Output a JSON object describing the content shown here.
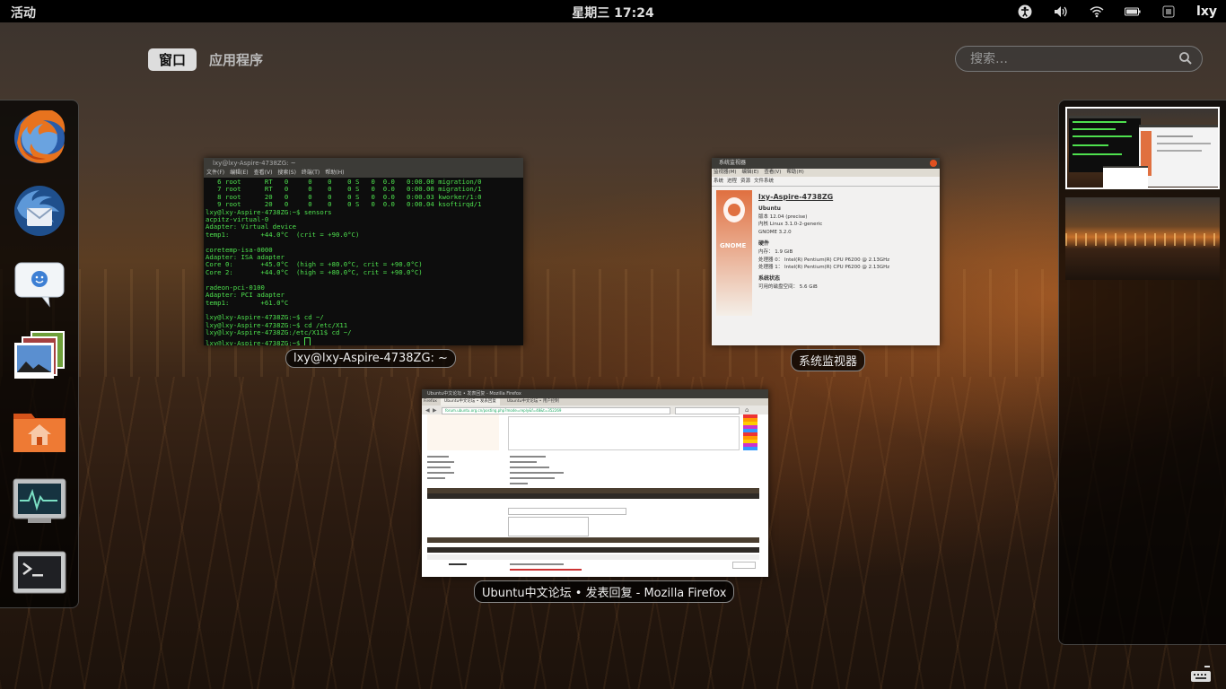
{
  "topbar": {
    "activities": "活动",
    "clock": "星期三 17:24",
    "username": "lxy",
    "icons": [
      "accessibility-icon",
      "volume-icon",
      "wifi-icon",
      "battery-icon"
    ]
  },
  "overview": {
    "tabs": [
      {
        "label": "窗口",
        "active": true
      },
      {
        "label": "应用程序",
        "active": false
      }
    ],
    "search": {
      "placeholder": "搜索…"
    }
  },
  "dash": {
    "items": [
      "firefox",
      "thunderbird",
      "empathy",
      "shotwell",
      "file-manager",
      "system-monitor",
      "terminal"
    ]
  },
  "windows": {
    "terminal": {
      "caption": "lxy@lxy-Aspire-4738ZG: ~",
      "title": "lxy@lxy-Aspire-4738ZG: ~",
      "menu": [
        "文件(F)",
        "编辑(E)",
        "查看(V)",
        "搜索(S)",
        "终端(T)",
        "帮助(H)"
      ],
      "lines": [
        "   6 root      RT   0     0    0    0 S   0  0.0   0:00.00 migration/0",
        "   7 root      RT   0     0    0    0 S   0  0.0   0:00.00 migration/1",
        "   8 root      20   0     0    0    0 S   0  0.0   0:00.03 kworker/1:0",
        "   9 root      20   0     0    0    0 S   0  0.0   0:00.04 ksoftirqd/1",
        "lxy@lxy-Aspire-4738ZG:~$ sensors",
        "acpitz-virtual-0",
        "Adapter: Virtual device",
        "temp1:        +44.0°C  (crit = +90.0°C)",
        "",
        "coretemp-isa-0000",
        "Adapter: ISA adapter",
        "Core 0:       +45.0°C  (high = +80.0°C, crit = +90.0°C)",
        "Core 2:       +44.0°C  (high = +80.0°C, crit = +90.0°C)",
        "",
        "radeon-pci-0100",
        "Adapter: PCI adapter",
        "temp1:        +61.0°C",
        "",
        "lxy@lxy-Aspire-4738ZG:~$ cd ~/",
        "lxy@lxy-Aspire-4738ZG:~$ cd /etc/X11",
        "lxy@lxy-Aspire-4738ZG:/etc/X11$ cd ~/",
        "lxy@lxy-Aspire-4738ZG:~$ "
      ]
    },
    "sysmon": {
      "caption": "系统监视器",
      "title": "系统监视器",
      "menu": [
        "监视器(M)",
        "编辑(E)",
        "查看(V)",
        "帮助(H)"
      ],
      "tabs": [
        "系统",
        "进程",
        "资源",
        "文件系统"
      ],
      "hostname": "lxy-Aspire-4738ZG",
      "os": "Ubuntu",
      "release": "版本 12.04 (precise)",
      "kernel": "内核 Linux 3.1.0-2-generic",
      "gnome": "GNOME 3.2.0",
      "hw_title": "硬件",
      "memory": "内存：        1.9 GiB",
      "cpu0": "处理器 0：   Intel(R) Pentium(R) CPU        P6200 @ 2.13GHz",
      "cpu1": "处理器 1：   Intel(R) Pentium(R) CPU        P6200 @ 2.13GHz",
      "status_title": "系统状态",
      "disk": "可用的磁盘空间：   5.6 GiB",
      "logo_text": "GNOME"
    },
    "firefox": {
      "caption": "Ubuntu中文论坛 • 发表回复 - Mozilla Firefox",
      "title": "Ubuntu中文论坛 • 发表回复 - Mozilla Firefox",
      "tabs": [
        "Firefox",
        "Ubuntu中文论坛 • 发表回复",
        "Ubuntu中文论坛 • 用户控制"
      ],
      "url": "forum.ubuntu.org.cn/posting.php?mode=reply&f=48&t=352269"
    }
  },
  "workspaces": [
    {
      "active": true
    },
    {
      "active": false
    }
  ]
}
